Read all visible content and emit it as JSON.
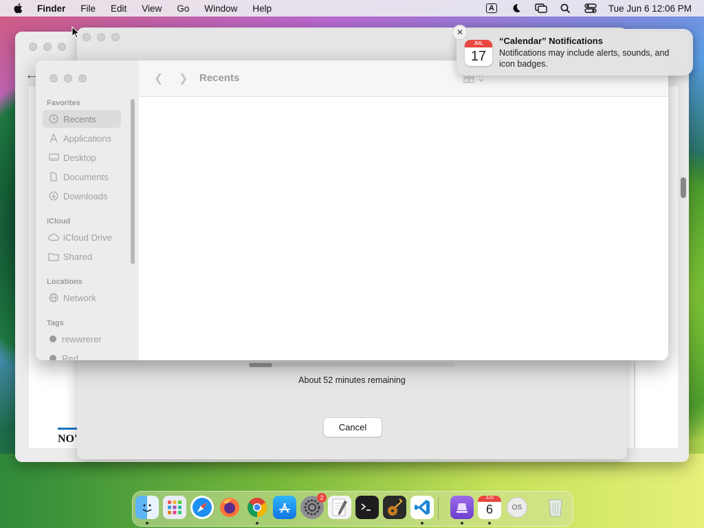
{
  "menubar": {
    "app_name": "Finder",
    "menus": [
      "File",
      "Edit",
      "View",
      "Go",
      "Window",
      "Help"
    ],
    "input_indicator": "A",
    "clock": "Tue Jun 6  12:06 PM"
  },
  "background_window": {
    "partial_text": "NO'"
  },
  "progress_dialog": {
    "status_text": "About 52 minutes remaining",
    "cancel_label": "Cancel"
  },
  "finder": {
    "title": "Recents",
    "sidebar": {
      "favorites_title": "Favorites",
      "favorites": [
        {
          "label": "Recents",
          "icon": "clock-icon"
        },
        {
          "label": "Applications",
          "icon": "applications-icon"
        },
        {
          "label": "Desktop",
          "icon": "desktop-icon"
        },
        {
          "label": "Documents",
          "icon": "document-icon"
        },
        {
          "label": "Downloads",
          "icon": "download-icon"
        }
      ],
      "icloud_title": "iCloud",
      "icloud": [
        {
          "label": "iCloud Drive",
          "icon": "cloud-icon"
        },
        {
          "label": "Shared",
          "icon": "shared-folder-icon"
        }
      ],
      "locations_title": "Locations",
      "locations": [
        {
          "label": "Network",
          "icon": "network-icon"
        }
      ],
      "tags_title": "Tags",
      "tags": [
        {
          "label": "rewwrerer",
          "color": "#9b9b9b"
        },
        {
          "label": "Red",
          "color": "#9b9b9b"
        }
      ]
    }
  },
  "notification": {
    "title": "“Calendar” Notifications",
    "body": "Notifications may include alerts, sounds, and icon badges.",
    "icon_month": "JUL",
    "icon_day": "17"
  },
  "dock": {
    "calendar_month": "JUN",
    "calendar_day": "6",
    "settings_badge": "2",
    "macos_installer_label": "OS"
  }
}
